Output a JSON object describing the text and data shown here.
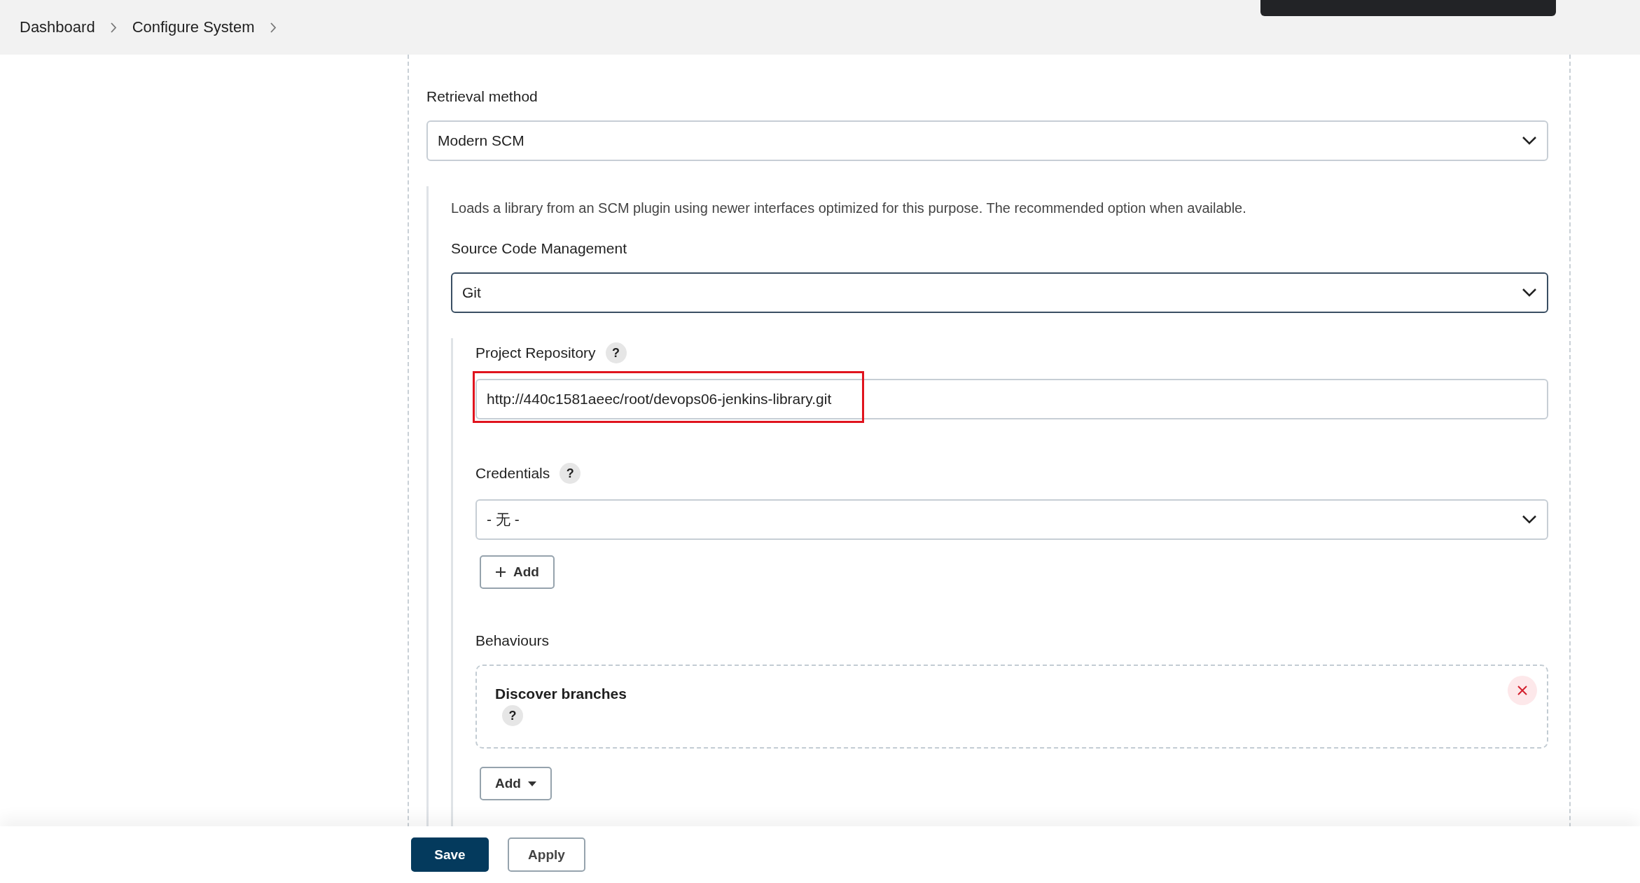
{
  "breadcrumbs": [
    {
      "label": "Dashboard"
    },
    {
      "label": "Configure System"
    }
  ],
  "retrieval": {
    "label": "Retrieval method",
    "value": "Modern SCM"
  },
  "scm": {
    "description": "Loads a library from an SCM plugin using newer interfaces optimized for this purpose. The recommended option when available.",
    "label": "Source Code Management",
    "value": "Git",
    "focused": true
  },
  "repository": {
    "label": "Project Repository",
    "help": "?",
    "value": "http://440c1581aeec/root/devops06-jenkins-library.git",
    "highlighted": true
  },
  "credentials": {
    "label": "Credentials",
    "help": "?",
    "value": "- 无 -",
    "add_button": "Add"
  },
  "behaviours": {
    "label": "Behaviours",
    "items": [
      {
        "title": "Discover branches",
        "help": "?"
      }
    ],
    "add_button": "Add"
  },
  "footer": {
    "buttons": [
      {
        "label": "Save",
        "kind": "primary"
      },
      {
        "label": "Apply",
        "kind": "secondary"
      }
    ]
  }
}
